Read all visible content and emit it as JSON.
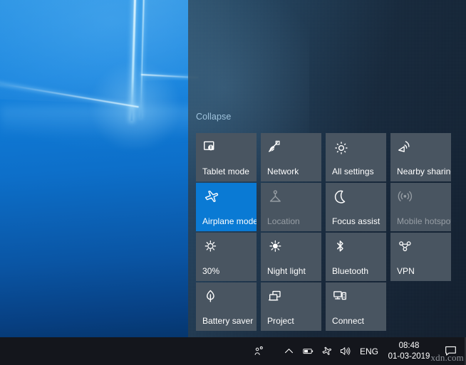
{
  "desktop": {
    "wallpaper_name": "windows-10-hero-wallpaper",
    "accent_color": "#0a7ad4",
    "wallpaper_blue": "#0d6fc9"
  },
  "action_center": {
    "collapse_label": "Collapse",
    "panel_color": "#1a2a3c",
    "tile_color": "#495561",
    "tile_on_color": "#0a7ad4",
    "notifications": [],
    "tiles": [
      {
        "label": "Tablet mode",
        "icon": "tablet-mode-icon",
        "state": "off"
      },
      {
        "label": "Network",
        "icon": "network-wifi-icon",
        "state": "off"
      },
      {
        "label": "All settings",
        "icon": "settings-gear-icon",
        "state": "off"
      },
      {
        "label": "Nearby sharing",
        "icon": "nearby-sharing-icon",
        "state": "off"
      },
      {
        "label": "Airplane mode",
        "icon": "airplane-icon",
        "state": "on"
      },
      {
        "label": "Location",
        "icon": "location-icon",
        "state": "disabled"
      },
      {
        "label": "Focus assist",
        "icon": "moon-icon",
        "state": "off"
      },
      {
        "label": "Mobile hotspot",
        "icon": "hotspot-icon",
        "state": "disabled"
      },
      {
        "label": "30%",
        "icon": "brightness-icon",
        "state": "off"
      },
      {
        "label": "Night light",
        "icon": "night-light-icon",
        "state": "off"
      },
      {
        "label": "Bluetooth",
        "icon": "bluetooth-icon",
        "state": "off"
      },
      {
        "label": "VPN",
        "icon": "vpn-icon",
        "state": "off"
      },
      {
        "label": "Battery saver",
        "icon": "leaf-icon",
        "state": "off"
      },
      {
        "label": "Project",
        "icon": "project-screens-icon",
        "state": "off"
      },
      {
        "label": "Connect",
        "icon": "connect-device-icon",
        "state": "off"
      }
    ]
  },
  "taskbar": {
    "people_icon": "people-icon",
    "chevron_icon": "chevron-up-icon",
    "battery_icon": "battery-icon",
    "airplane_icon": "airplane-icon",
    "volume_icon": "volume-icon",
    "language": "ENG",
    "time": "08:48",
    "date": "01-03-2019",
    "action_center_icon": "action-center-icon",
    "watermark": "xdn.com"
  }
}
